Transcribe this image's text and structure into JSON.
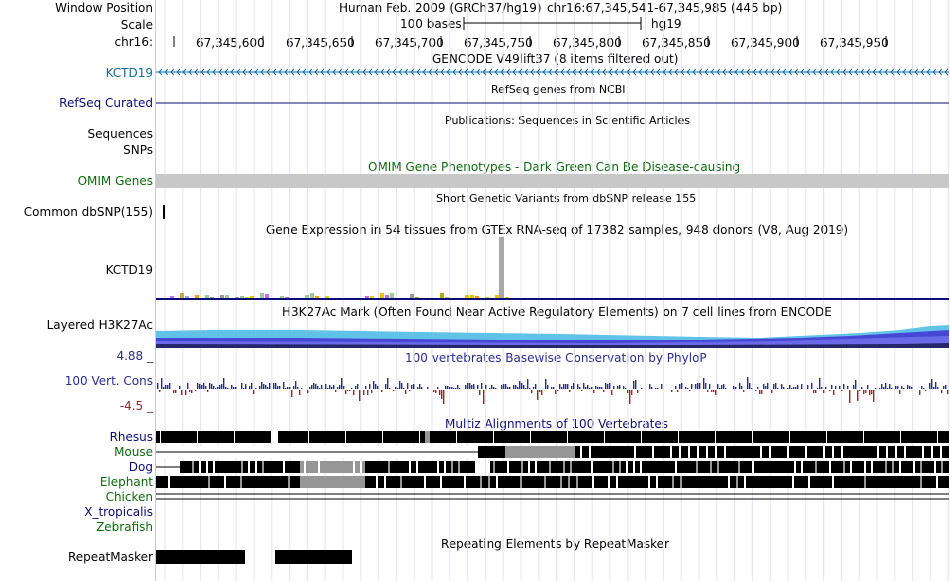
{
  "header": {
    "window_position_label": "Window Position",
    "scale_label": "Scale",
    "chrom_label": "chr16:",
    "assembly": "Human Feb. 2009 (GRCh37/hg19)",
    "position": "chr16:67,345,541-67,345,985 (445 bp)",
    "scale_bases": "100 bases",
    "scale_db": "hg19",
    "ticks": [
      "67,345,600",
      "67,345,650",
      "67,345,700",
      "67,345,750",
      "67,345,800",
      "67,345,850",
      "67,345,900",
      "67,345,950"
    ]
  },
  "tracks": {
    "gencode": {
      "title": "GENCODE V49lift37 (8 items filtered out)",
      "gene": "KCTD19"
    },
    "refseq": {
      "title": "RefSeq genes from NCBI",
      "label": "RefSeq Curated"
    },
    "publications": {
      "title": "Publications: Sequences in Scientific Articles",
      "label": "Sequences"
    },
    "snps": {
      "label": "SNPs"
    },
    "omim": {
      "title": "OMIM Gene Phenotypes - Dark Green Can Be Disease-causing",
      "label": "OMIM Genes"
    },
    "dbsnp": {
      "title": "Short Genetic Variants from dbSNP release 155",
      "label": "Common dbSNP(155)"
    },
    "gtex": {
      "title": "Gene Expression in 54 tissues from GTEx RNA-seq of 17382 samples, 948 donors (V8, Aug 2019)",
      "label": "KCTD19"
    },
    "h3k27ac": {
      "title": "H3K27Ac Mark (Often Found Near Active Regulatory Elements) on 7 cell lines from ENCODE",
      "label": "Layered H3K27Ac"
    },
    "phylop": {
      "title": "100 vertebrates Basewise Conservation by PhyloP",
      "label": "100 Vert. Cons",
      "max": "4.88 _",
      "min": "-4.5 _"
    },
    "multiz": {
      "title": "Multiz Alignments of 100 Vertebrates",
      "species": [
        "Rhesus",
        "Mouse",
        "Dog",
        "Elephant",
        "Chicken",
        "X_tropicalis",
        "Zebrafish"
      ]
    },
    "repeatmasker": {
      "title": "Repeating Elements by RepeatMasker",
      "label": "RepeatMasker"
    }
  },
  "colors": {
    "gencode_blue": "#0c6ea3",
    "refseq_navy": "#0c0c78",
    "omim_green": "#0d6a0d",
    "omim_bar": "#c8c8c8",
    "phylop_navy": "#2b2b8f",
    "phylop_red": "#8f2b2b",
    "h3k27ac_cyan": "#61c2e8",
    "multiz_gray": "#969696"
  }
}
